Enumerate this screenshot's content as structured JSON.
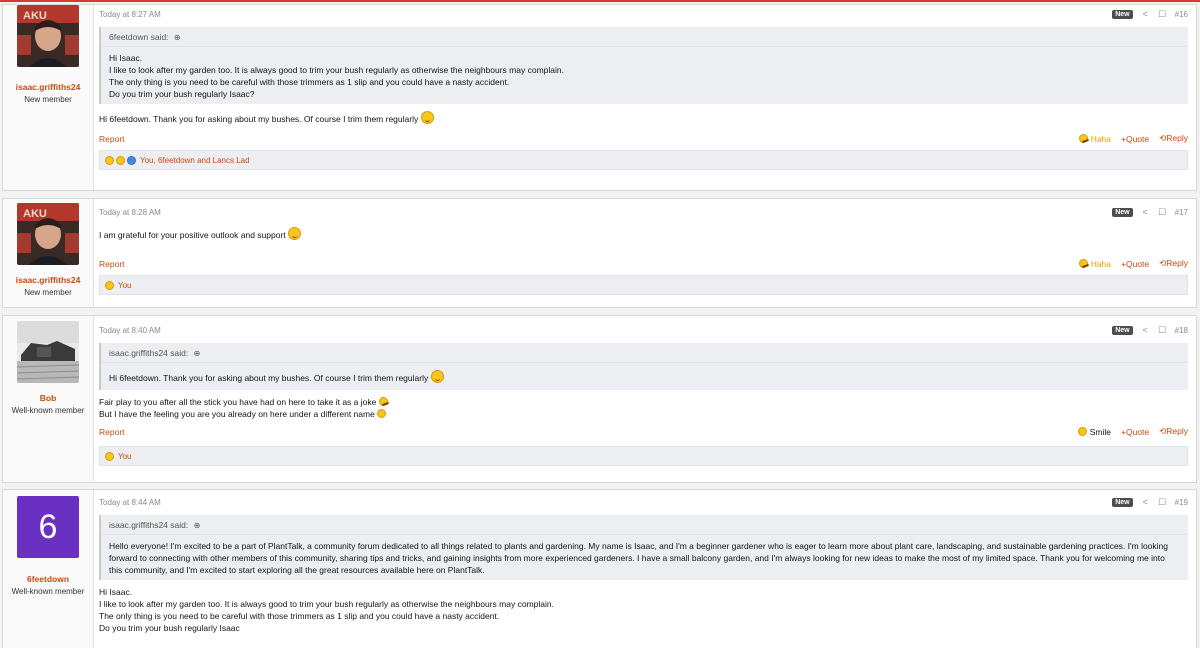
{
  "posts": [
    {
      "id": 16,
      "number": "#16",
      "date": "Today at 8:27 AM",
      "user": {
        "name": "isaac.griffiths24",
        "title": "New member"
      },
      "new_badge": "New",
      "quote": {
        "author": "6feetdown said:",
        "lines": [
          "Hi Isaac.",
          "I like to look after my garden too. It is always good to trim your bush regularly as otherwise the neighbours may complain.",
          "The only thing is you need to be careful with those trimmers as 1 slip and you could have a nasty accident.",
          "Do you trim your bush regularly Isaac?"
        ]
      },
      "content": [
        "Hi 6feetdown. Thank you for asking about my bushes. Of course I trim them regularly"
      ],
      "report": "Report",
      "reaction_label": "Haha",
      "quote_label": "+Quote",
      "reply_label": "Reply",
      "reactions_text": "You, 6feetdown and Lancs Lad"
    },
    {
      "id": 17,
      "number": "#17",
      "date": "Today at 8:28 AM",
      "user": {
        "name": "isaac.griffiths24",
        "title": "New member"
      },
      "new_badge": "New",
      "content": [
        "I am grateful for your positive outlook and support"
      ],
      "report": "Report",
      "reaction_label": "Haha",
      "quote_label": "+Quote",
      "reply_label": "Reply",
      "reactions_text": "You"
    },
    {
      "id": 18,
      "number": "#18",
      "date": "Today at 8:40 AM",
      "user": {
        "name": "Bob",
        "title": "Well-known member"
      },
      "new_badge": "New",
      "quote": {
        "author": "isaac.griffiths24 said:",
        "lines": [
          "Hi 6feetdown. Thank you for asking about my bushes. Of course I trim them regularly"
        ]
      },
      "content": [
        "Fair play to you after all the stick you have had on here to take it as a joke",
        "But I have the feeling you are you already on here under a different name"
      ],
      "report": "Report",
      "reaction_label": "Smile",
      "quote_label": "+Quote",
      "reply_label": "Reply",
      "reactions_text": "You"
    },
    {
      "id": 19,
      "number": "#19",
      "date": "Today at 8:44 AM",
      "user": {
        "name": "6feetdown",
        "title": "Well-known member",
        "avatar_letter": "6"
      },
      "new_badge": "New",
      "quote": {
        "author": "isaac.griffiths24 said:",
        "lines": [
          "Hello everyone! I'm excited to be a part of PlantTalk, a community forum dedicated to all things related to plants and gardening. My name is Isaac, and I'm a beginner gardener who is eager to learn more about plant care, landscaping, and sustainable gardening practices. I'm looking forward to connecting with other members of this community, sharing tips and tricks, and gaining insights from more experienced gardeners. I have a small balcony garden, and I'm always looking for new ideas to make the most of my limited space. Thank you for welcoming me into this community, and I'm excited to start exploring all the great resources available here on PlantTalk."
        ]
      },
      "content": [
        "Hi Isaac.",
        "I like to look after my garden too. It is always good to trim your bush regularly as otherwise the neighbours may complain.",
        "The only thing is you need to be careful with those trimmers as 1 slip and you could have a nasty accident.",
        "Do you trim your bush regularly Isaac"
      ]
    }
  ],
  "icons": {
    "share": "share-icon",
    "bookmark": "bookmark-icon",
    "expand": "expand-arrow-icon",
    "reply": "reply-icon"
  },
  "colors": {
    "accent": "#c84b0c",
    "new_badge": "#4d4d4d",
    "avatar_purple": "#6a30c2",
    "top_line": "#d83a2e"
  }
}
